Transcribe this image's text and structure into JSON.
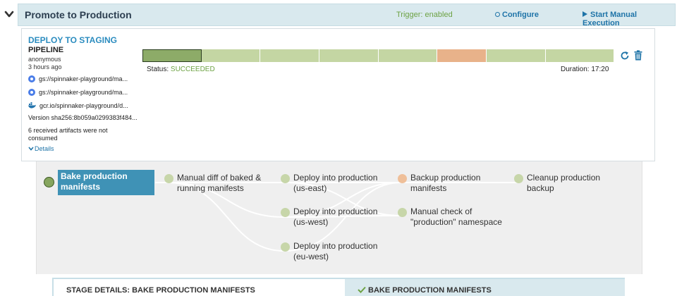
{
  "header": {
    "title": "Promote to Production",
    "trigger": "Trigger: enabled",
    "configure": "Configure",
    "manual_execution": "Start Manual Execution"
  },
  "execution": {
    "pipeline_name": "DEPLOY TO STAGING",
    "pipeline_label": "PIPELINE",
    "user": "anonymous",
    "time_ago": "3 hours ago",
    "artifacts": [
      {
        "icon": "gcs-icon",
        "text": "gs://spinnaker-playground/ma..."
      },
      {
        "icon": "gcs-icon",
        "text": "gs://spinnaker-playground/ma..."
      },
      {
        "icon": "docker-icon",
        "text": "gcr.io/spinnaker-playground/d..."
      }
    ],
    "version": "Version  sha256:8b059a0299383f484...",
    "not_consumed": "6 received artifacts were not consumed",
    "details_link": "Details",
    "status_label": "Status: ",
    "status_value": "SUCCEEDED",
    "duration": "Duration: 17:20",
    "stage_segments": [
      {
        "status": "succeeded",
        "color": "#8dab68",
        "width_fraction": 0.125
      },
      {
        "status": "succeeded",
        "color": "#c4d6a3",
        "width_fraction": 0.125
      },
      {
        "status": "succeeded",
        "color": "#c4d6a3",
        "width_fraction": 0.125
      },
      {
        "status": "succeeded",
        "color": "#c4d6a3",
        "width_fraction": 0.125
      },
      {
        "status": "succeeded",
        "color": "#c4d6a3",
        "width_fraction": 0.125
      },
      {
        "status": "manual",
        "color": "#e8b28a",
        "width_fraction": 0.105
      },
      {
        "status": "succeeded",
        "color": "#c4d6a3",
        "width_fraction": 0.125
      },
      {
        "status": "succeeded",
        "color": "#c4d6a3",
        "width_fraction": 0.145
      }
    ]
  },
  "graph": {
    "nodes": [
      {
        "id": "bake",
        "label": "Bake production manifests",
        "status": "active"
      },
      {
        "id": "diff",
        "label": "Manual diff of baked & running manifests",
        "status": "succeeded"
      },
      {
        "id": "us_east",
        "label": "Deploy into production (us-east)",
        "status": "succeeded"
      },
      {
        "id": "us_west",
        "label": "Deploy into production (us-west)",
        "status": "succeeded"
      },
      {
        "id": "eu_west",
        "label": "Deploy into production (eu-west)",
        "status": "succeeded"
      },
      {
        "id": "backup",
        "label": "Backup production manifests",
        "status": "manual"
      },
      {
        "id": "check",
        "label": "Manual check of \"production\" namespace",
        "status": "succeeded"
      },
      {
        "id": "cleanup",
        "label": "Cleanup production backup",
        "status": "succeeded"
      }
    ]
  },
  "details_panel": {
    "left_title": "STAGE DETAILS: BAKE PRODUCTION MANIFESTS",
    "right_title": "BAKE PRODUCTION MANIFESTS"
  },
  "colors": {
    "accent": "#2b8cbf",
    "success": "#6da244",
    "manual": "#efbf99",
    "active_node": "#3f92b6"
  }
}
